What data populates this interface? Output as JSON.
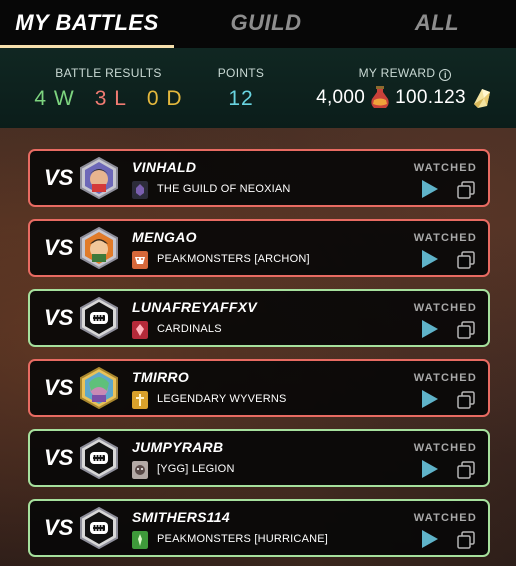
{
  "tabs": [
    {
      "label": "MY BATTLES",
      "active": true
    },
    {
      "label": "GUILD",
      "active": false
    },
    {
      "label": "ALL",
      "active": false
    }
  ],
  "summary": {
    "battle_results_label": "BATTLE RESULTS",
    "wins": "4 W",
    "losses": "3 L",
    "draws": "0 D",
    "points_label": "POINTS",
    "points": "12",
    "reward_label": "MY REWARD",
    "reward_amount_1": "4,000",
    "reward_icon_1": "potion-icon",
    "reward_amount_2": "100.123",
    "reward_icon_2": "crystal-icon"
  },
  "battles": [
    {
      "vs": "VS",
      "opponent": "VINHALD",
      "guild": "THE GUILD OF NEOXIAN",
      "status": "WATCHED",
      "result": "loss",
      "guild_color": "#7a5fb0"
    },
    {
      "vs": "VS",
      "opponent": "MENGAO",
      "guild": "PEAKMONSTERS [ARCHON]",
      "status": "WATCHED",
      "result": "loss",
      "guild_color": "#d6683a"
    },
    {
      "vs": "VS",
      "opponent": "LUNAFREYAFFXV",
      "guild": "CARDINALS",
      "status": "WATCHED",
      "result": "win",
      "guild_color": "#b52a3a"
    },
    {
      "vs": "VS",
      "opponent": "TMIRRO",
      "guild": "LEGENDARY WYVERNS",
      "status": "WATCHED",
      "result": "loss",
      "guild_color": "#d9a12b"
    },
    {
      "vs": "VS",
      "opponent": "JUMPYRARB",
      "guild": "[YGG] LEGION",
      "status": "WATCHED",
      "result": "win",
      "guild_color": "#b3a9a5"
    },
    {
      "vs": "VS",
      "opponent": "SMITHERS114",
      "guild": "PEAKMONSTERS [HURRICANE]",
      "status": "WATCHED",
      "result": "win",
      "guild_color": "#3e9a3a"
    }
  ],
  "colors": {
    "win": "#a6e09d",
    "loss": "#e86b62",
    "draw": "#e4b83d",
    "points": "#69d4e0",
    "accent": "#f6dfad",
    "play": "#5fb3c9"
  }
}
